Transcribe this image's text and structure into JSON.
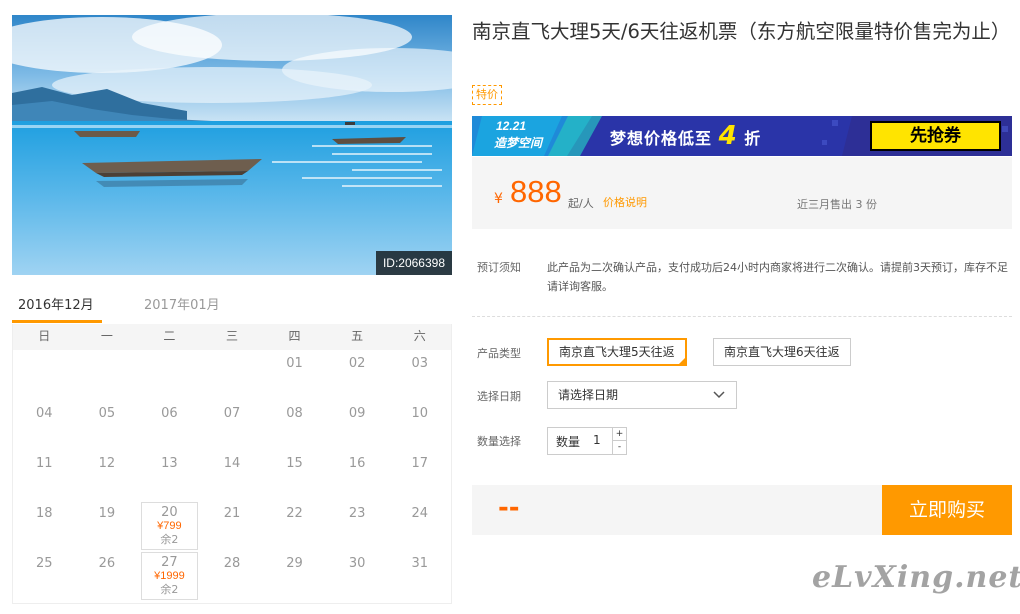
{
  "photo": {
    "id_label": "ID:2066398"
  },
  "calendar": {
    "tabs": [
      {
        "label": "2016年12月",
        "active": true
      },
      {
        "label": "2017年01月",
        "active": false
      }
    ],
    "weekdays": [
      "日",
      "一",
      "二",
      "三",
      "四",
      "五",
      "六"
    ],
    "weeks": [
      [
        {
          "d": ""
        },
        {
          "d": ""
        },
        {
          "d": ""
        },
        {
          "d": ""
        },
        {
          "d": "01"
        },
        {
          "d": "02"
        },
        {
          "d": "03"
        }
      ],
      [
        {
          "d": "04"
        },
        {
          "d": "05"
        },
        {
          "d": "06"
        },
        {
          "d": "07"
        },
        {
          "d": "08"
        },
        {
          "d": "09"
        },
        {
          "d": "10"
        }
      ],
      [
        {
          "d": "11"
        },
        {
          "d": "12"
        },
        {
          "d": "13"
        },
        {
          "d": "14"
        },
        {
          "d": "15"
        },
        {
          "d": "16"
        },
        {
          "d": "17"
        }
      ],
      [
        {
          "d": "18"
        },
        {
          "d": "19"
        },
        {
          "d": "20",
          "price": "¥799",
          "stock": "余2"
        },
        {
          "d": "21"
        },
        {
          "d": "22"
        },
        {
          "d": "23"
        },
        {
          "d": "24"
        }
      ],
      [
        {
          "d": "25"
        },
        {
          "d": "26"
        },
        {
          "d": "27",
          "price": "¥1999",
          "stock": "余2"
        },
        {
          "d": "28"
        },
        {
          "d": "29"
        },
        {
          "d": "30"
        },
        {
          "d": "31"
        }
      ]
    ]
  },
  "product": {
    "title": "南京直飞大理5天/6天往返机票（东方航空限量特价售完为止）",
    "badge": "特价"
  },
  "banner": {
    "date": "12.21",
    "sub": "造梦空间",
    "text_before": "梦想价格低至",
    "big": "4",
    "text_after": "折",
    "button": "先抢券",
    "colors": {
      "background": "#2a34a8",
      "accent": "#ffe400"
    }
  },
  "price": {
    "currency": "¥",
    "value": "888",
    "unit": "起/人",
    "note_link": "价格说明",
    "sold": "近三月售出 3 份"
  },
  "notice": {
    "label": "预订须知",
    "text": "此产品为二次确认产品，支付成功后24小时内商家将进行二次确认。请提前3天预订，库存不足请详询客服。"
  },
  "options": {
    "type_label": "产品类型",
    "types": [
      {
        "label": "南京直飞大理5天往返",
        "selected": true
      },
      {
        "label": "南京直飞大理6天往返",
        "selected": false
      }
    ],
    "date_label": "选择日期",
    "date_placeholder": "请选择日期",
    "qty_label_row": "数量选择",
    "qty_label": "数量",
    "qty_value": "1",
    "plus": "+",
    "minus": "-"
  },
  "buy": {
    "total": "--",
    "button": "立即购买"
  },
  "watermark": "eLvXing.net",
  "colors": {
    "accent": "#ff9900",
    "price": "#ff6600"
  }
}
